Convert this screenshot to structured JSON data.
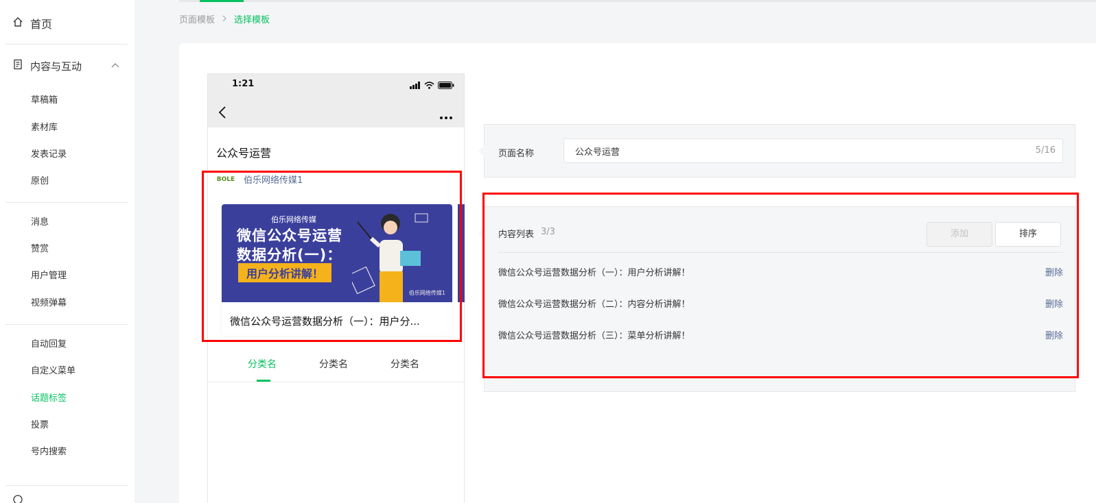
{
  "sidebar": {
    "home_label": "首页",
    "group_label": "内容与互动",
    "items": [
      {
        "label": "草稿箱"
      },
      {
        "label": "素材库"
      },
      {
        "label": "发表记录"
      },
      {
        "label": "原创"
      },
      {
        "label": "消息"
      },
      {
        "label": "赞赏"
      },
      {
        "label": "用户管理"
      },
      {
        "label": "视频弹幕"
      },
      {
        "label": "自动回复"
      },
      {
        "label": "自定义菜单"
      },
      {
        "label": "话题标签",
        "active": true
      },
      {
        "label": "投票"
      },
      {
        "label": "号内搜索"
      }
    ]
  },
  "breadcrumb": {
    "first": "页面模板",
    "current": "选择模板"
  },
  "phone": {
    "time": "1:21",
    "page_title": "公众号运营",
    "account_name": "伯乐网络传媒1",
    "account_logo": "BOLE",
    "card": {
      "image_brand": "伯乐网络传媒",
      "image_title_line1": "微信公众号运营",
      "image_title_line2": "数据分析(一)：",
      "image_subtitle": "用户分析讲解！",
      "image_watermark": "伯乐网络传媒1",
      "caption": "微信公众号运营数据分析（一）：用户分..."
    },
    "tabs": [
      "分类名",
      "分类名",
      "分类名"
    ]
  },
  "form": {
    "page_name_label": "页面名称",
    "page_name_value": "公众号运营",
    "page_name_counter": "5/16"
  },
  "content_list": {
    "label": "内容列表",
    "count": "3/3",
    "add_label": "添加",
    "sort_label": "排序",
    "items": [
      {
        "title": "微信公众号运营数据分析（一）：用户分析讲解！",
        "action": "删除"
      },
      {
        "title": "微信公众号运营数据分析（二）：内容分析讲解！",
        "action": "删除"
      },
      {
        "title": "微信公众号运营数据分析（三）：菜单分析讲解！",
        "action": "删除"
      }
    ]
  },
  "colors": {
    "accent": "#07c160",
    "link": "#576b95",
    "highlight_border": "#ff0000",
    "card_bg": "#3b3f9c",
    "card_badge": "#f5b21b"
  }
}
